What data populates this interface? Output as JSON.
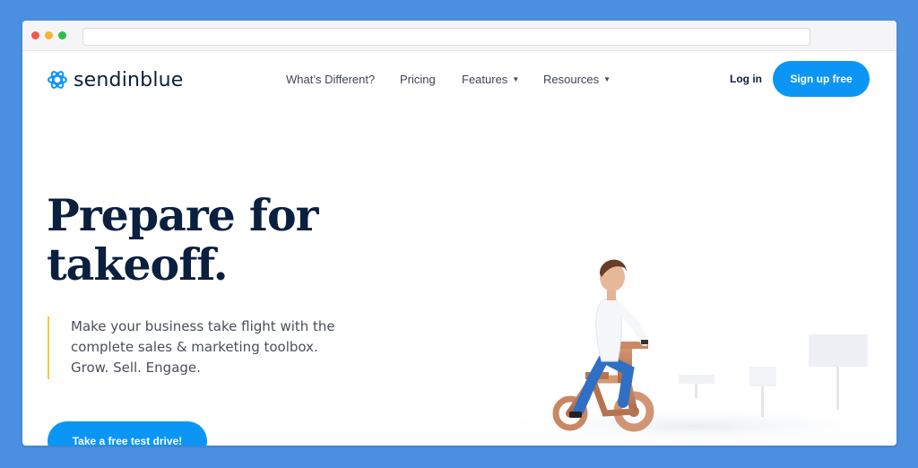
{
  "brand": {
    "name": "sendinblue",
    "accent": "#0b96f5",
    "dark": "#0b1f3f",
    "highlight": "#f7c948",
    "background": "#4a8fe0"
  },
  "nav": {
    "links": [
      {
        "label": "What’s Different?",
        "has_dropdown": false
      },
      {
        "label": "Pricing",
        "has_dropdown": false
      },
      {
        "label": "Features",
        "has_dropdown": true
      },
      {
        "label": "Resources",
        "has_dropdown": true
      }
    ],
    "login_label": "Log in",
    "signup_label": "Sign up free"
  },
  "hero": {
    "headline_line1": "Prepare for",
    "headline_line2": "takeoff.",
    "subtext_line1": "Make your business take flight with the",
    "subtext_line2": "complete sales & marketing toolbox.",
    "subtext_line3": "Grow. Sell. Engage.",
    "cta_label": "Take a free test drive!"
  }
}
